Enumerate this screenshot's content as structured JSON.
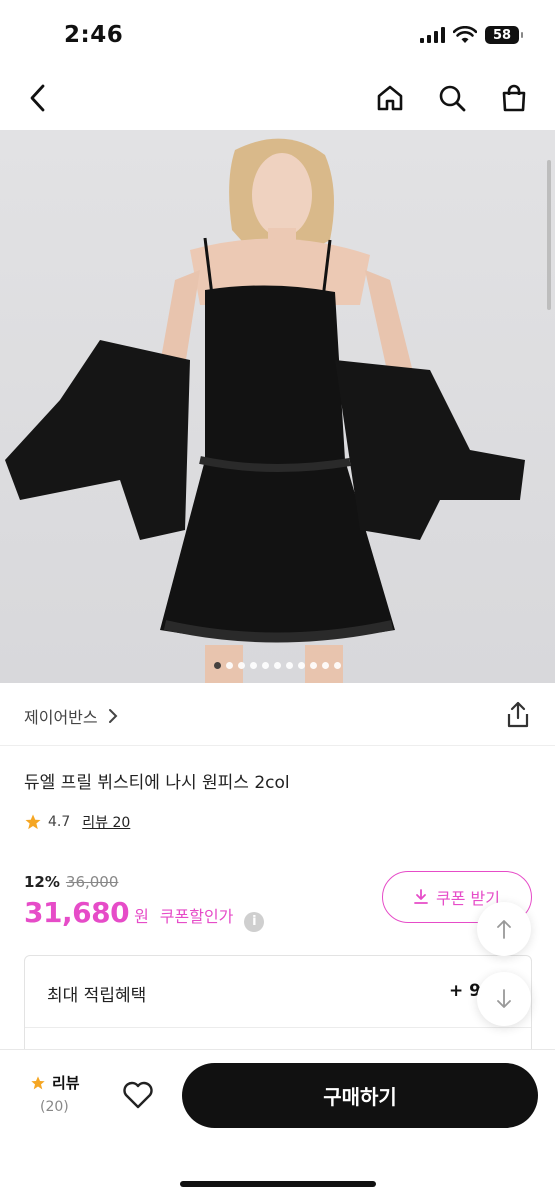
{
  "status": {
    "time": "2:46",
    "battery": "58"
  },
  "nav": {
    "back_icon": "chevron-left-icon",
    "home_icon": "home-icon",
    "search_icon": "search-icon",
    "cart_icon": "shopping-bag-icon"
  },
  "gallery": {
    "total_images": 11,
    "active_index": 0
  },
  "brand": {
    "name": "제이어반스",
    "share_icon": "share-icon"
  },
  "product": {
    "title": "듀엘 프릴 뷔스티에 나시 원피스 2col",
    "rating": "4.7",
    "review_label": "리뷰 20",
    "discount": "12%",
    "original_price": "36,000",
    "price": "31,680",
    "price_unit": "원",
    "coupon_price_label": "쿠폰할인가",
    "coupon_button": "쿠폰 받기"
  },
  "benefit": {
    "title": "최대 적립혜택",
    "value": "+ 9"
  },
  "bottom_bar": {
    "review_label": "리뷰",
    "review_count": "(20)",
    "buy_label": "구매하기"
  },
  "colors": {
    "accent": "#e64cc8",
    "star": "#f5a623",
    "buy_button": "#111111"
  }
}
